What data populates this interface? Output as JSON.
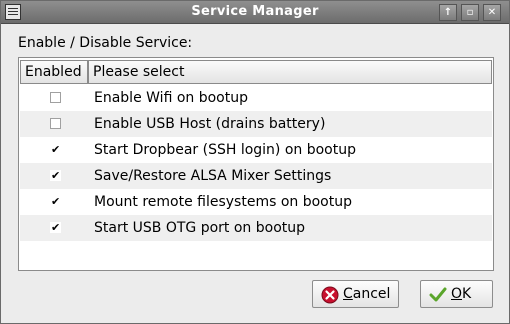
{
  "window": {
    "title": "Service Manager",
    "controls": {
      "up": "↑",
      "restore": "▫",
      "close": "✕"
    }
  },
  "section_label": "Enable / Disable Service:",
  "table": {
    "columns": [
      "Enabled",
      "Please select"
    ],
    "rows": [
      {
        "checked": false,
        "label": "Enable Wifi on bootup"
      },
      {
        "checked": false,
        "label": "Enable USB Host (drains battery)"
      },
      {
        "checked": true,
        "label": "Start Dropbear (SSH login) on bootup"
      },
      {
        "checked": true,
        "label": "Save/Restore ALSA Mixer Settings"
      },
      {
        "checked": true,
        "label": "Mount remote filesystems on bootup"
      },
      {
        "checked": true,
        "label": "Start USB OTG port on bootup"
      }
    ]
  },
  "buttons": {
    "cancel": {
      "first": "C",
      "rest": "ancel",
      "icon": "cancel-icon",
      "color": "#c8102e"
    },
    "ok": {
      "first": "O",
      "rest": "K",
      "icon": "checkmark-icon",
      "color": "#5aa52b"
    }
  }
}
